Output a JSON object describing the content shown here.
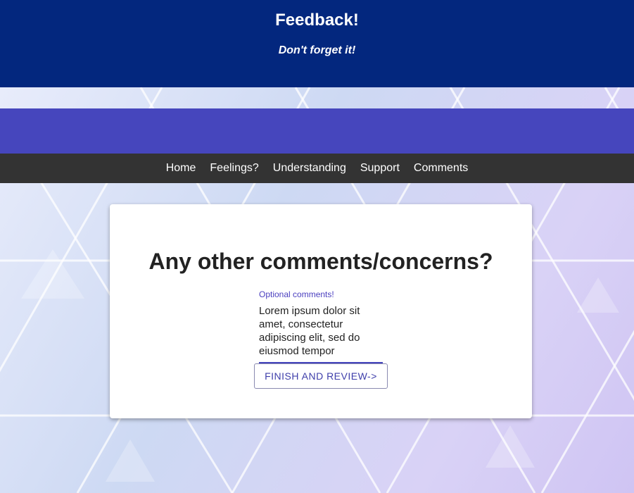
{
  "header": {
    "title": "Feedback!",
    "subtitle": "Don't forget it!"
  },
  "nav": {
    "items": [
      "Home",
      "Feelings?",
      "Understanding",
      "Support",
      "Comments"
    ]
  },
  "card": {
    "heading": "Any other comments/concerns?",
    "comments_label": "Optional comments!",
    "comments_value": "Lorem ipsum dolor sit amet, consectetur adipiscing elit, sed do eiusmod tempor",
    "finish_button_label": "FINISH AND REVIEW->"
  },
  "colors": {
    "header_bg": "#03277e",
    "banner_bg": "#4646bd",
    "nav_bg": "#333333",
    "accent": "#4a3fbf"
  }
}
